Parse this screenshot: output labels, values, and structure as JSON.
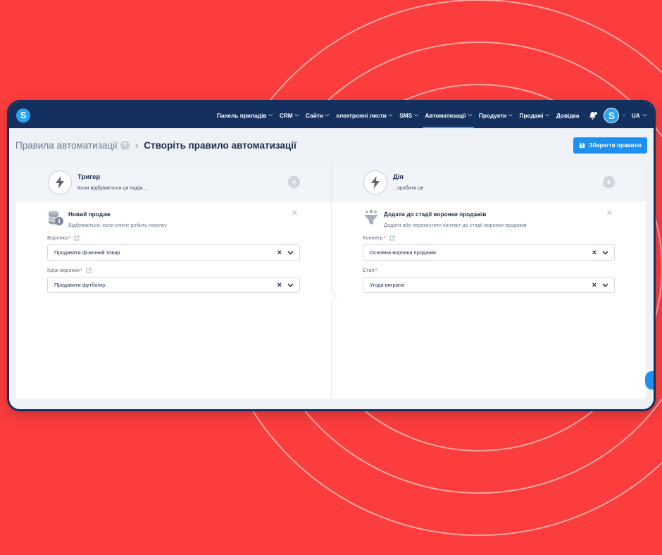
{
  "nav": {
    "logo": "S",
    "items": [
      {
        "label": "Панель приладів"
      },
      {
        "label": "CRM"
      },
      {
        "label": "Сайти"
      },
      {
        "label": "електронні листи"
      },
      {
        "label": "SMS"
      },
      {
        "label": "Автоматизації",
        "active": true
      },
      {
        "label": "Продукти"
      },
      {
        "label": "Продажі"
      },
      {
        "label": "Довідка"
      }
    ],
    "avatar": "S",
    "lang": "UA"
  },
  "breadcrumb": {
    "parent": "Правила автоматизації",
    "help": "?",
    "current": "Створіть правило автоматизації"
  },
  "save_button": "Зберегти правило",
  "trigger": {
    "title": "Тригер",
    "subtitle": "Коли відбувається ця подія...",
    "card_title": "Новий продаж",
    "card_subtitle": "Відбувається, коли клієнт робить покупку",
    "fields": [
      {
        "label": "Воронка",
        "value": "Продавати фізичний товар"
      },
      {
        "label": "Крок воронки",
        "value": "Продавати футболку"
      }
    ]
  },
  "action": {
    "title": "Дія",
    "subtitle": "...зробити це",
    "card_title": "Додати до стадії воронки продажів",
    "card_subtitle": "Додати або перемістити контакт до стадії воронки продажів",
    "fields": [
      {
        "label": "Конвеєр",
        "value": "Основна воронка продажів"
      },
      {
        "label": "Етап",
        "value": "Угода виграна"
      }
    ]
  },
  "colors": {
    "background": "#fb3d3d",
    "navbar": "#14305f",
    "accent": "#1e90f0"
  }
}
